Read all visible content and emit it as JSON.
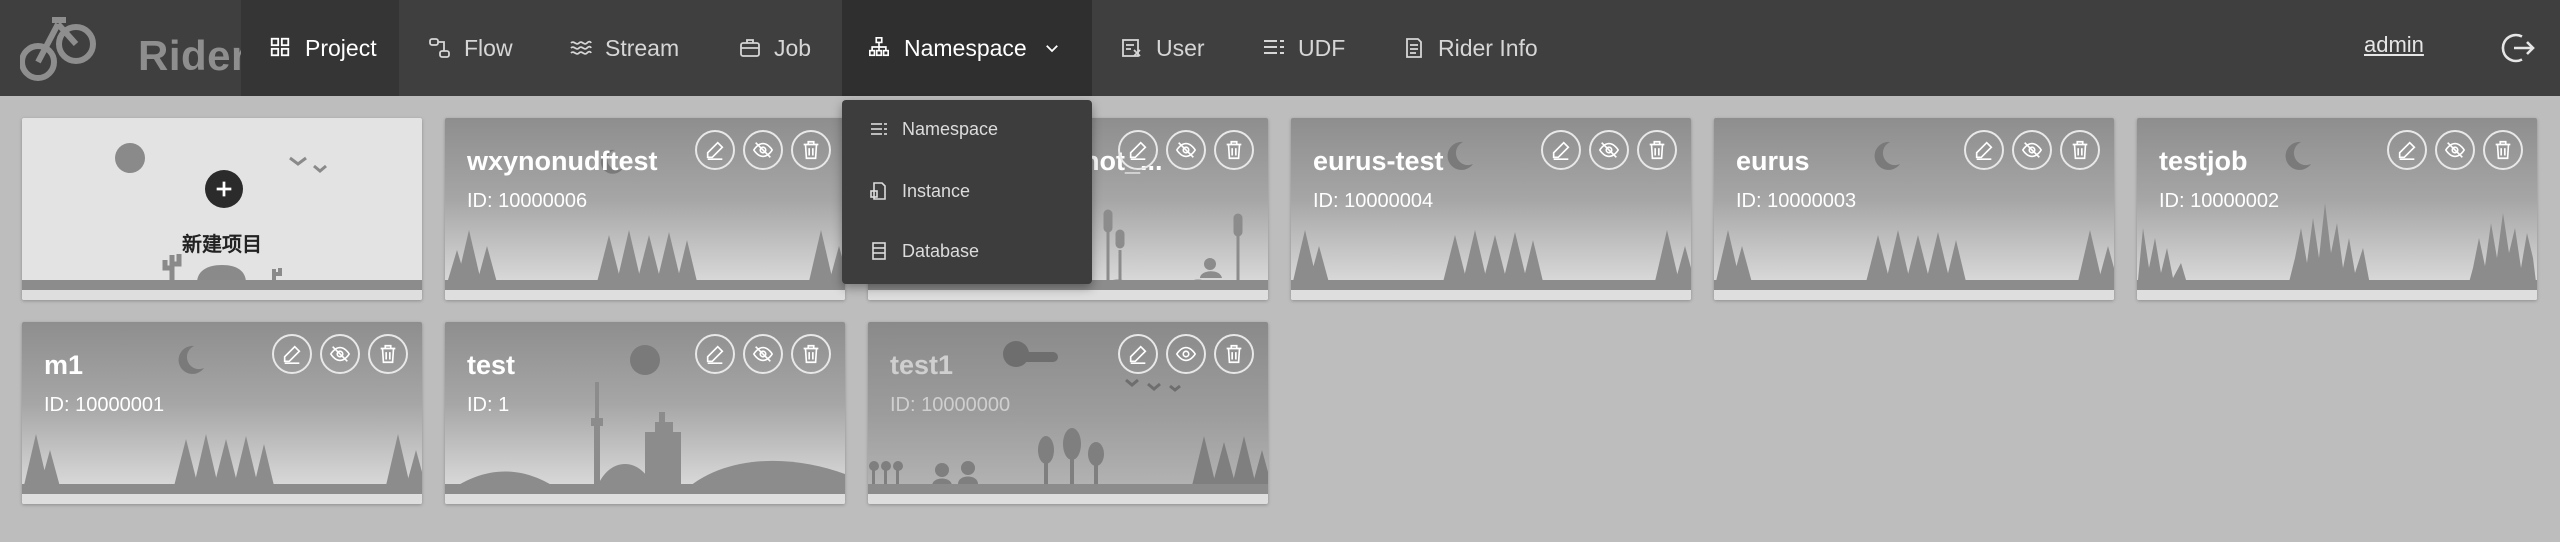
{
  "app": {
    "name": "Rider"
  },
  "nav": {
    "project": "Project",
    "flow": "Flow",
    "stream": "Stream",
    "job": "Job",
    "namespace": "Namespace",
    "user": "User",
    "udf": "UDF",
    "rider_info": "Rider Info"
  },
  "user": {
    "name": "admin"
  },
  "namespace_menu": {
    "items": [
      "Namespace",
      "Instance",
      "Database"
    ]
  },
  "new_project": {
    "label": "新建项目"
  },
  "cards": [
    {
      "name": "wxynonudftest",
      "id": "ID:  10000006",
      "visibility": "hidden"
    },
    {
      "name": "_not_...",
      "id": "",
      "visibility": "hidden"
    },
    {
      "name": "eurus-test",
      "id": "ID:  10000004",
      "visibility": "hidden"
    },
    {
      "name": "eurus",
      "id": "ID:  10000003",
      "visibility": "hidden"
    },
    {
      "name": "testjob",
      "id": "ID:  10000002",
      "visibility": "hidden"
    },
    {
      "name": "m1",
      "id": "ID:  10000001",
      "visibility": "hidden"
    },
    {
      "name": "test",
      "id": "ID:  1",
      "visibility": "hidden"
    },
    {
      "name": "test1",
      "id": "ID:  10000000",
      "visibility": "visible"
    }
  ],
  "icons": {
    "project": "grid-icon",
    "flow": "flow-icon",
    "stream": "waves-icon",
    "job": "briefcase-icon",
    "namespace": "sitemap-icon",
    "user": "user-card-icon",
    "udf": "list-icon",
    "rider_info": "document-icon",
    "logout": "logout-icon",
    "edit": "edit-icon",
    "hide": "eye-slash-icon",
    "show": "eye-icon",
    "delete": "trash-icon"
  },
  "colors": {
    "topbar": "#3f3f3f",
    "background": "#bdbdbd",
    "dropdown": "#3d3d3d"
  }
}
